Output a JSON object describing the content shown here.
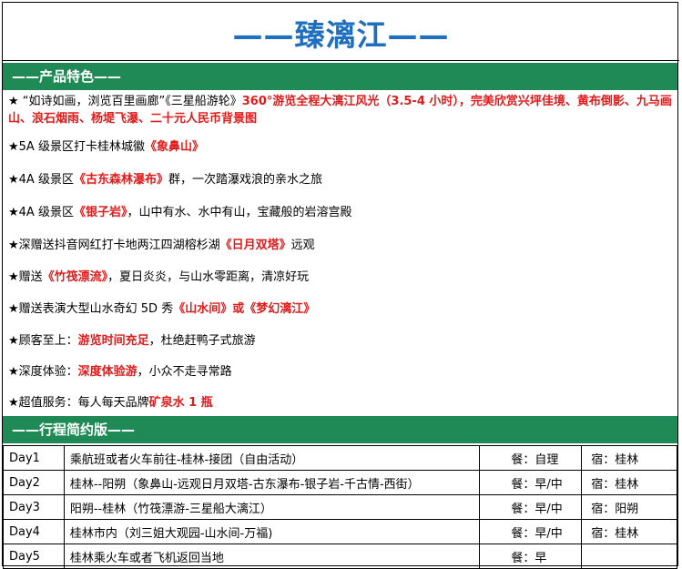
{
  "title": "——臻漓江——",
  "features_header": "——产品特色——",
  "features": [
    [
      {
        "t": "★ “如诗如画，浏览百里画廊”《三星船游轮》",
        "r": false
      },
      {
        "t": "360°游览全程大漓江风光（3.5-4 小时），完美欣赏兴坪佳境、黄布倒影、九马画山、浪石烟雨、杨堤飞瀑、二十元人民币背景图",
        "r": true
      }
    ],
    [
      {
        "t": "★5A 级景区打卡桂林城徽",
        "r": false
      },
      {
        "t": "《象鼻山》",
        "r": true
      }
    ],
    [
      {
        "t": "★4A 级景区",
        "r": false
      },
      {
        "t": "《古东森林瀑布》",
        "r": true
      },
      {
        "t": "群，一次踏瀑戏浪的亲水之旅",
        "r": false
      }
    ],
    [
      {
        "t": "★4A 级景区",
        "r": false
      },
      {
        "t": "《银子岩》",
        "r": true
      },
      {
        "t": "，山中有水、水中有山，宝藏般的岩溶宫殿",
        "r": false
      }
    ],
    [
      {
        "t": "★深赠送抖音网红打卡地两江四湖榕杉湖",
        "r": false
      },
      {
        "t": "《日月双塔》",
        "r": true
      },
      {
        "t": "远观",
        "r": false
      }
    ],
    [
      {
        "t": "★赠送",
        "r": false
      },
      {
        "t": "《竹筏漂流》",
        "r": true
      },
      {
        "t": "，夏日炎炎，与山水零距离，清凉好玩",
        "r": false
      }
    ],
    [
      {
        "t": "★赠送表演大型山水奇幻 5D 秀",
        "r": false
      },
      {
        "t": "《山水间》或《梦幻漓江》",
        "r": true
      }
    ],
    [
      {
        "t": "★顾客至上：",
        "r": false
      },
      {
        "t": "游览时间充足",
        "r": true
      },
      {
        "t": "，杜绝赶鸭子式旅游",
        "r": false
      }
    ],
    [
      {
        "t": "★深度体验：",
        "r": false
      },
      {
        "t": "深度体验游",
        "r": true
      },
      {
        "t": "，小众不走寻常路",
        "r": false
      }
    ],
    [
      {
        "t": "★超值服务：每人每天品牌",
        "r": false
      },
      {
        "t": "矿泉水 1 瓶",
        "r": true
      }
    ]
  ],
  "itinerary_header": "——行程简约版——",
  "itinerary": [
    {
      "day": "Day1",
      "route": "乘航班或者火车前往-桂林-接团（自由活动）",
      "meal": "餐：自理",
      "stay": "宿：桂林"
    },
    {
      "day": "Day2",
      "route": "桂林--阳朔（象鼻山-远观日月双塔-古东瀑布-银子岩-千古情-西街）",
      "meal": "餐：早/中",
      "stay": "宿：桂林"
    },
    {
      "day": "Day3",
      "route": "阳朔--桂林（竹筏漂游-三星船大漓江）",
      "meal": "餐：早/中",
      "stay": "宿：阳朔"
    },
    {
      "day": "Day4",
      "route": "桂林市内（刘三姐大观园-山水间-万福)",
      "meal": "餐：早/中",
      "stay": "宿：桂林"
    },
    {
      "day": "Day5",
      "route": "桂林乘火车或者飞机返回当地",
      "meal": "餐：早",
      "stay": ""
    }
  ],
  "colors": {
    "title": "#1f6fc0",
    "band": "#1f8a56",
    "highlight": "#e01b1b"
  }
}
